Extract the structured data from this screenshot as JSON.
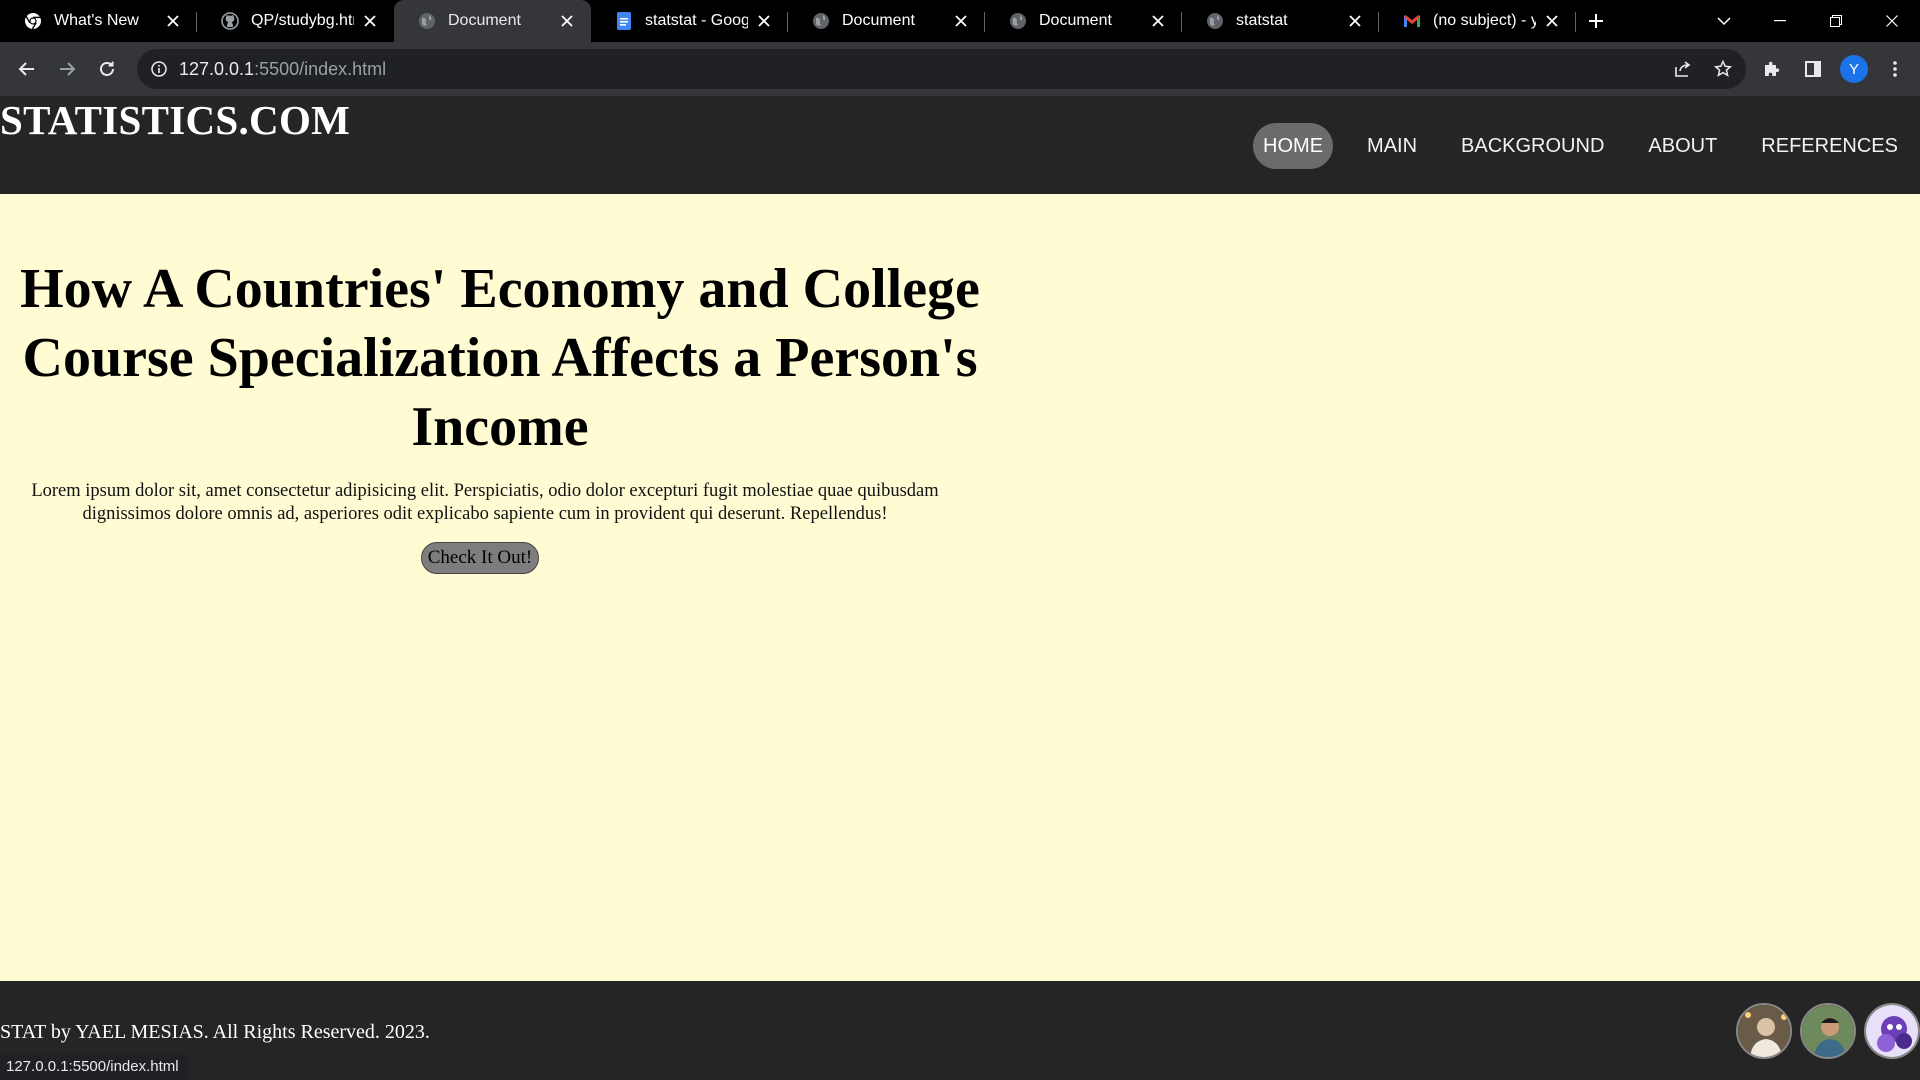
{
  "browser": {
    "tabs": [
      {
        "title": "What's New",
        "icon": "chrome-icon"
      },
      {
        "title": "QP/studybg.html",
        "icon": "github-icon"
      },
      {
        "title": "Document",
        "icon": "globe-icon",
        "active": true
      },
      {
        "title": "statstat - Google",
        "icon": "google-docs-icon"
      },
      {
        "title": "Document",
        "icon": "globe-icon"
      },
      {
        "title": "Document",
        "icon": "globe-icon"
      },
      {
        "title": "statstat",
        "icon": "globe-icon"
      },
      {
        "title": "(no subject) - ya",
        "icon": "gmail-icon"
      }
    ],
    "url_host": "127.0.0.1",
    "url_rest": ":5500/index.html",
    "profile_initial": "Y",
    "status_url": "127.0.0.1:5500/index.html"
  },
  "site": {
    "brand": "STATISTICS.COM",
    "nav": [
      "HOME",
      "MAIN",
      "BACKGROUND",
      "ABOUT",
      "REFERENCES"
    ],
    "hero": {
      "title": "How A Countries' Economy and College Course Specialization Affects a Person's Income",
      "body": "Lorem ipsum dolor sit, amet consectetur adipisicing elit. Perspiciatis, odio dolor excepturi fugit molestiae quae quibusdam dignissimos dolore omnis ad, asperiores odit explicabo sapiente cum in provident qui deserunt. Repellendus!",
      "button": "Check It Out!"
    },
    "footer": "STAT by YAEL MESIAS. All Rights Reserved. 2023."
  },
  "colors": {
    "page_bg": "#fffbd2",
    "header_bg": "#252525",
    "nav_active_bg": "#6b6b6b",
    "button_bg": "#7d7d7d",
    "profile_blue": "#1a73e8"
  }
}
